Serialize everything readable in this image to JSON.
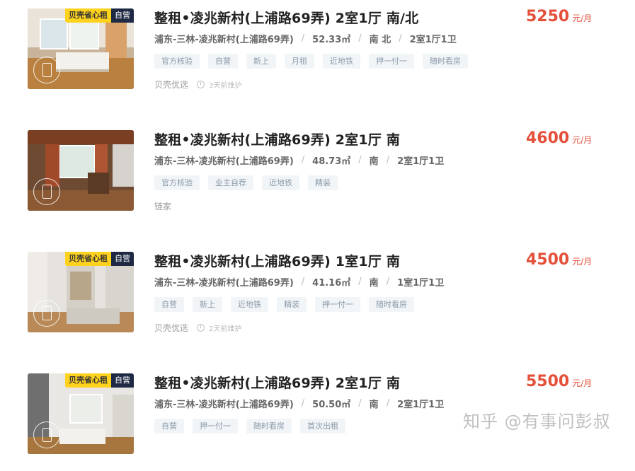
{
  "listings": [
    {
      "title": "整租•凌兆新村(上浦路69弄) 2室1厅 南/北",
      "location": "浦东-三林-凌兆新村(上浦路69弄)",
      "area": "52.33㎡",
      "orientation": "南 北",
      "layout": "2室1厅1卫",
      "tags": [
        "官方核验",
        "自营",
        "新上",
        "月租",
        "近地铁",
        "押一付一",
        "随时看房"
      ],
      "source": "贝壳优选",
      "maintained": "3天前维护",
      "price": "5250",
      "price_unit": "元/月",
      "badge_brand": "贝壳省心租",
      "badge_self": "自营"
    },
    {
      "title": "整租•凌兆新村(上浦路69弄) 2室1厅 南",
      "location": "浦东-三林-凌兆新村(上浦路69弄)",
      "area": "48.73㎡",
      "orientation": "南",
      "layout": "2室1厅1卫",
      "tags": [
        "官方核验",
        "业主自荐",
        "近地铁",
        "精装"
      ],
      "source": "链家",
      "maintained": "",
      "price": "4600",
      "price_unit": "元/月",
      "badge_brand": "",
      "badge_self": ""
    },
    {
      "title": "整租•凌兆新村(上浦路69弄) 1室1厅 南",
      "location": "浦东-三林-凌兆新村(上浦路69弄)",
      "area": "41.16㎡",
      "orientation": "南",
      "layout": "1室1厅1卫",
      "tags": [
        "自营",
        "新上",
        "近地铁",
        "精装",
        "押一付一",
        "随时看房"
      ],
      "source": "贝壳优选",
      "maintained": "2天前维护",
      "price": "4500",
      "price_unit": "元/月",
      "badge_brand": "贝壳省心租",
      "badge_self": "自营"
    },
    {
      "title": "整租•凌兆新村(上浦路69弄) 2室1厅 南",
      "location": "浦东-三林-凌兆新村(上浦路69弄)",
      "area": "50.50㎡",
      "orientation": "南",
      "layout": "2室1厅1卫",
      "tags": [
        "自营",
        "押一付一",
        "随时看房",
        "首次出租"
      ],
      "source": "",
      "maintained": "",
      "price": "5500",
      "price_unit": "元/月",
      "badge_brand": "贝壳省心租",
      "badge_self": "自营"
    }
  ],
  "watermark": "知乎 @有事问彭叔",
  "colors": {
    "price": "#e4503a",
    "badge_brand": "#ffd21e",
    "badge_self": "#1e2a44",
    "tag_bg": "#f2f5f8"
  }
}
